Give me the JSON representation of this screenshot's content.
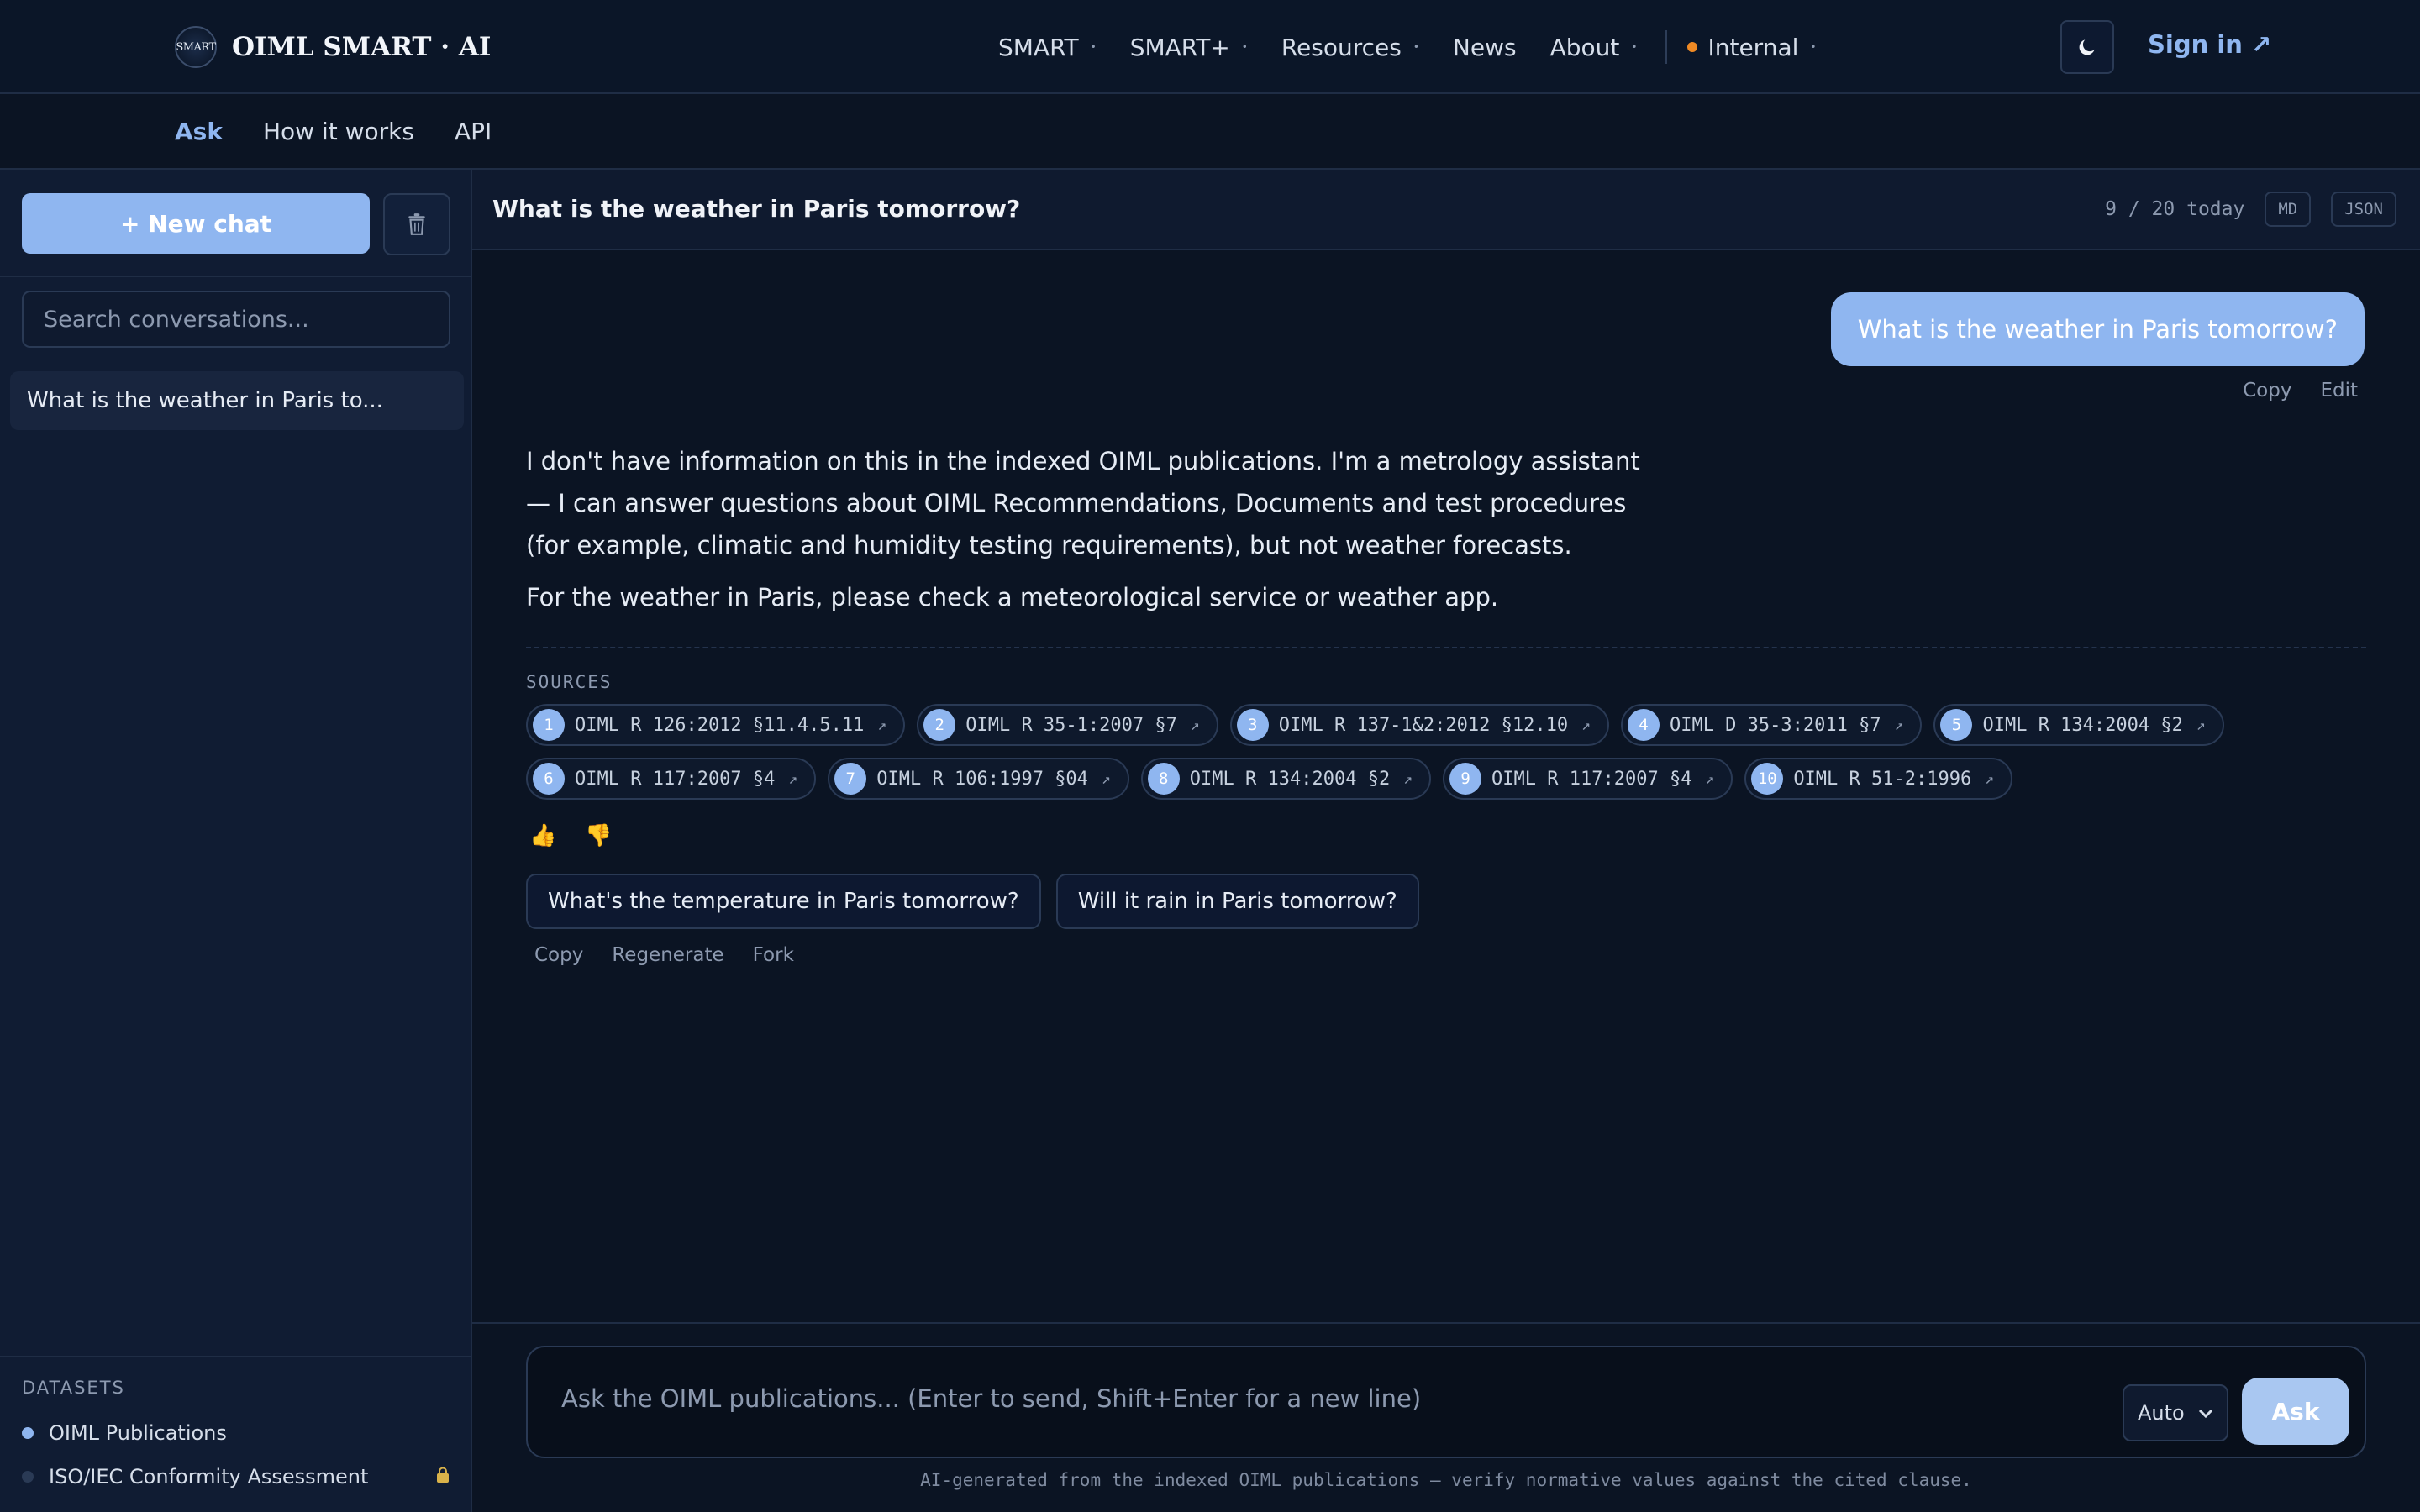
{
  "brand": {
    "logo_text": "SMART",
    "name": "OIML SMART · AI"
  },
  "nav": {
    "items": [
      {
        "label": "SMART",
        "has_menu": true
      },
      {
        "label": "SMART+",
        "has_menu": true
      },
      {
        "label": "Resources",
        "has_menu": true
      },
      {
        "label": "News",
        "has_menu": false
      },
      {
        "label": "About",
        "has_menu": true
      }
    ],
    "internal": "Internal",
    "caret": "•",
    "theme_icon": "moon-icon",
    "sign_in": "Sign in ↗"
  },
  "subnav": {
    "tabs": [
      "Ask",
      "How it works",
      "API"
    ],
    "active": "Ask"
  },
  "sidebar": {
    "new_chat": "+ New chat",
    "search_placeholder": "Search conversations...",
    "conversations": [
      "What is the weather in Paris to..."
    ],
    "datasets_title": "DATASETS",
    "datasets": [
      {
        "label": "OIML Publications",
        "active": true,
        "color": "#8fb6f0"
      },
      {
        "label": "ISO/IEC Conformity Assessment",
        "active": false,
        "color": "#2a3a55",
        "locked": true
      }
    ]
  },
  "chat": {
    "title": "What is the weather in Paris tomorrow?",
    "count": "9 / 20 today",
    "md": "MD",
    "json": "JSON",
    "user_message": "What is the weather in Paris tomorrow?",
    "user_actions": [
      "Copy",
      "Edit"
    ],
    "answer": [
      "I don't have information on this in the indexed OIML publications. I'm a metrology assistant — I can answer questions about OIML Recommendations, Documents and test procedures (for example, climatic and humidity testing requirements), but not weather forecasts.",
      "For the weather in Paris, please check a meteorological service or weather app."
    ],
    "sources_label": "SOURCES",
    "sources": [
      [
        "OIML R 126:2012 §11.4.5.11",
        "OIML R 35-1:2007 §7",
        "OIML R 137-1&2:2012 §12.10",
        "OIML D 35-3:2011 §7",
        "OIML R 134:2004 §2"
      ],
      [
        "OIML R 117:2007 §4",
        "OIML R 106:1997 §04",
        "OIML R 134:2004 §2",
        "OIML R 117:2007 §4",
        "OIML R 51-2:1996"
      ]
    ],
    "suggestions": [
      "What's the temperature in Paris tomorrow?",
      "Will it rain in Paris tomorrow?"
    ],
    "message_actions": [
      "Copy",
      "Regenerate",
      "Fork"
    ]
  },
  "composer": {
    "placeholder": "Ask the OIML publications... (Enter to send, Shift+Enter for a new line)",
    "mode": "Auto",
    "ask": "Ask",
    "disclaimer": "AI-generated from the indexed OIML publications — verify normative values against the cited clause."
  }
}
